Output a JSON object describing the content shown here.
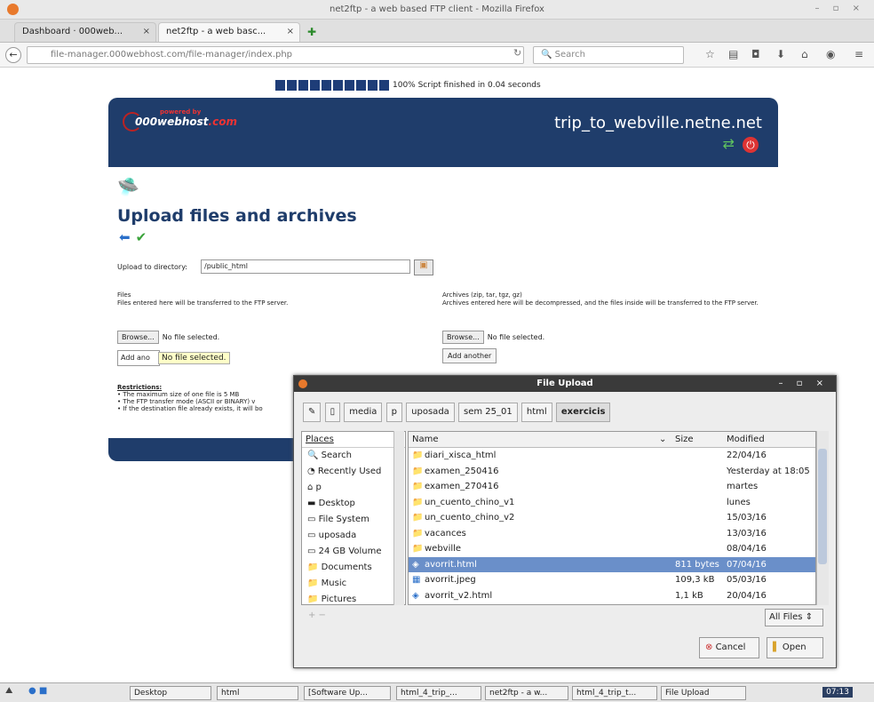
{
  "window": {
    "title": "net2ftp - a web based FTP client - Mozilla Firefox",
    "controls": "– ▫ ×"
  },
  "tabs": [
    {
      "label": "Dashboard · 000web...",
      "close": "×"
    },
    {
      "label": "net2ftp - a web basc...",
      "close": "×"
    }
  ],
  "nav": {
    "url": "file-manager.000webhost.com/file-manager/index.php",
    "search_placeholder": "Search"
  },
  "progress": {
    "blocks": 10,
    "text": "100% Script finished in 0.04 seconds"
  },
  "header": {
    "logo_text": "000webhost",
    "logo_suffix": ".com",
    "powered": "powered by",
    "site_name": "trip_to_webville.netne.net"
  },
  "page": {
    "title": "Upload files and archives",
    "upload_dir_label": "Upload to directory:",
    "upload_dir_value": "/public_html",
    "files_title": "Files",
    "files_desc": "Files entered here will be transferred to the FTP server.",
    "archives_title": "Archives (zip, tar, tgz, gz)",
    "archives_desc": "Archives entered here will be decompressed, and the files inside will be transferred to the FTP server.",
    "browse_label": "Browse...",
    "no_file": "No file selected.",
    "add_another": "Add another",
    "add_another_partial": "Add ano",
    "tooltip": "No file selected.",
    "restrictions_title": "Restrictions:",
    "restrictions": [
      "• The maximum size of one file is 5 MB",
      "• The FTP transfer mode (ASCII or BINARY) v",
      "• If the destination file already exists, it will bo"
    ]
  },
  "dialog": {
    "title": "File Upload",
    "crumbs": [
      "media",
      "p",
      "uposada",
      "sem 25_01",
      "html",
      "exercicis"
    ],
    "places_header": "Places",
    "places": [
      {
        "icon": "search-icon",
        "label": "Search"
      },
      {
        "icon": "recent-icon",
        "label": "Recently Used"
      },
      {
        "icon": "home-icon",
        "label": "p"
      },
      {
        "icon": "desktop-icon",
        "label": "Desktop"
      },
      {
        "icon": "drive-icon",
        "label": "File System"
      },
      {
        "icon": "drive-icon",
        "label": "uposada"
      },
      {
        "icon": "drive-icon",
        "label": "24 GB Volume"
      },
      {
        "icon": "folder-icon",
        "label": "Documents"
      },
      {
        "icon": "folder-icon",
        "label": "Music"
      },
      {
        "icon": "folder-icon",
        "label": "Pictures"
      }
    ],
    "columns": {
      "name": "Name",
      "size": "Size",
      "modified": "Modified"
    },
    "files": [
      {
        "icon": "folder-icon",
        "name": "diari_xisca_html",
        "size": "",
        "modified": "22/04/16"
      },
      {
        "icon": "folder-icon",
        "name": "examen_250416",
        "size": "",
        "modified": "Yesterday at 18:05"
      },
      {
        "icon": "folder-icon",
        "name": "examen_270416",
        "size": "",
        "modified": "martes"
      },
      {
        "icon": "folder-icon",
        "name": "un_cuento_chino_v1",
        "size": "",
        "modified": "lunes"
      },
      {
        "icon": "folder-icon",
        "name": "un_cuento_chino_v2",
        "size": "",
        "modified": "15/03/16"
      },
      {
        "icon": "folder-icon",
        "name": "vacances",
        "size": "",
        "modified": "13/03/16"
      },
      {
        "icon": "folder-icon",
        "name": "webville",
        "size": "",
        "modified": "08/04/16"
      },
      {
        "icon": "html-file-icon",
        "name": "avorrit.html",
        "size": "811 bytes",
        "modified": "07/04/16",
        "selected": true
      },
      {
        "icon": "image-file-icon",
        "name": "avorrit.jpeg",
        "size": "109,3 kB",
        "modified": "05/03/16"
      },
      {
        "icon": "html-file-icon",
        "name": "avorrit_v2.html",
        "size": "1,1 kB",
        "modified": "20/04/16"
      }
    ],
    "filter": "All Files",
    "cancel_label": "Cancel",
    "open_label": "Open"
  },
  "taskbar": {
    "items": [
      "Desktop",
      "html",
      "[Software Up...",
      "html_4_trip_...",
      "net2ftp - a w...",
      "html_4_trip_t...",
      "File Upload"
    ],
    "clock": "07:13"
  },
  "colors": {
    "brand_dark": "#1f3d6b",
    "selection": "#6a8fc9",
    "title_blue": "#1f3d6b"
  }
}
